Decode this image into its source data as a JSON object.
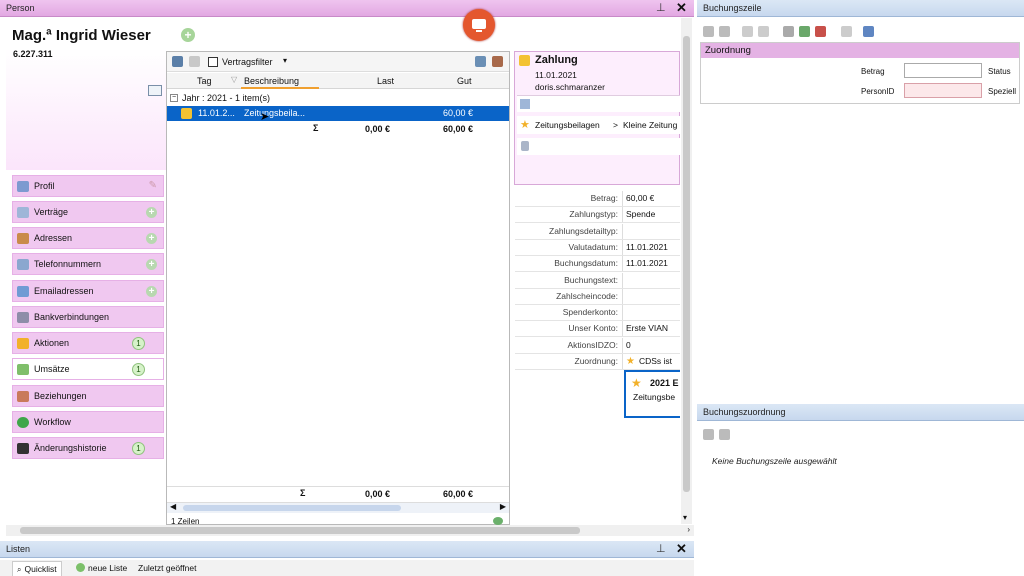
{
  "person_panel": {
    "title": "Person"
  },
  "person": {
    "name": "Mag.ª Ingrid Wieser",
    "id": "6.227.311"
  },
  "sidebar": {
    "items": [
      {
        "label": "Profil",
        "accessory": "pencil",
        "count": null
      },
      {
        "label": "Verträge",
        "accessory": "plus",
        "count": null
      },
      {
        "label": "Adressen",
        "accessory": "plus",
        "count": null
      },
      {
        "label": "Telefonnummern",
        "accessory": "plus",
        "count": null
      },
      {
        "label": "Emailadressen",
        "accessory": "plus",
        "count": null
      },
      {
        "label": "Bankverbindungen",
        "accessory": "none",
        "count": null
      },
      {
        "label": "Aktionen",
        "accessory": "none",
        "count": "1"
      },
      {
        "label": "Umsätze",
        "accessory": "none",
        "count": "1"
      },
      {
        "label": "Beziehungen",
        "accessory": "none",
        "count": null
      },
      {
        "label": "Workflow",
        "accessory": "none",
        "count": null
      },
      {
        "label": "Änderungshistorie",
        "accessory": "none",
        "count": "1"
      }
    ]
  },
  "grid": {
    "filter_label": "Vertragsfilter",
    "columns": {
      "tag": "Tag",
      "beschreibung": "Beschreibung",
      "last": "Last",
      "gut": "Gut"
    },
    "group_label": "Jahr : 2021 - 1 item(s)",
    "row": {
      "tag": "11.01.2...",
      "beschreibung": "Zeitungsbeila...",
      "last": "",
      "gut": "60,00 €"
    },
    "group_summary": {
      "sigma": "Σ",
      "last": "0,00 €",
      "gut": "60,00 €"
    },
    "footer_summary": {
      "sigma": "Σ",
      "last": "0,00 €",
      "gut": "60,00 €"
    },
    "row_count": "1 Zeilen"
  },
  "detail": {
    "header": {
      "title": "Zahlung",
      "date": "11.01.2021",
      "user": "doris.schmaranzer"
    },
    "breadcrumb": {
      "part1": "Zeitungsbeilagen",
      "sep": ">",
      "part2": "Kleine Zeitung"
    },
    "fields": [
      {
        "label": "Betrag:",
        "value": "60,00 €"
      },
      {
        "label": "Zahlungstyp:",
        "value": "Spende"
      },
      {
        "label": "Zahlungsdetailtyp:",
        "value": ""
      },
      {
        "label": "Valutadatum:",
        "value": "11.01.2021"
      },
      {
        "label": "Buchungsdatum:",
        "value": "11.01.2021"
      },
      {
        "label": "Buchungstext:",
        "value": ""
      },
      {
        "label": "Zahlscheincode:",
        "value": ""
      },
      {
        "label": "Spenderkonto:",
        "value": ""
      },
      {
        "label": "Unser Konto:",
        "value": "Erste VIAN"
      },
      {
        "label": "AktionsIDZO:",
        "value": "0"
      },
      {
        "label": "Zuordnung:",
        "value": "CDSs ist"
      }
    ],
    "zuordnung_card": {
      "title": "2021 E",
      "subtitle": "Zeitungsbe"
    }
  },
  "buchungszeile": {
    "title": "Buchungszeile",
    "section": "Zuordnung",
    "betrag_label": "Betrag",
    "status_label": "Status",
    "personid_label": "PersonID",
    "speziell_label": "Speziell",
    "betrag_value": "",
    "personid_value": ""
  },
  "buchungszuordnung": {
    "title": "Buchungszuordnung",
    "empty_text": "Keine Buchungszeile ausgewählt"
  },
  "listen": {
    "title": "Listen",
    "tabs": [
      "Quicklist",
      "neue Liste",
      "Zuletzt geöffnet"
    ]
  },
  "colors": {
    "accent_pink": "#e2a8e2",
    "selection_blue": "#0a64c8",
    "record_red": "#e4572e"
  }
}
